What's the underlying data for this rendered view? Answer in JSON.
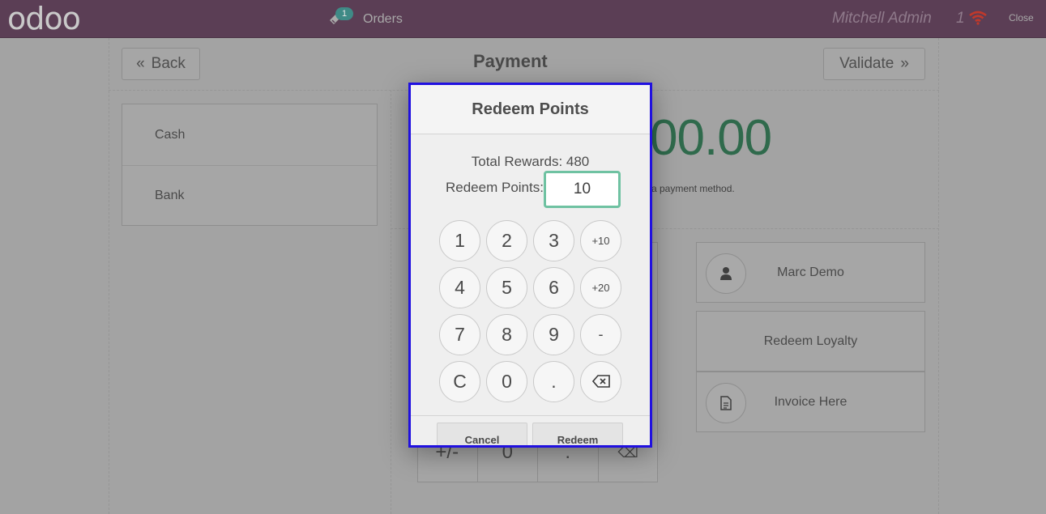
{
  "topbar": {
    "logo": "odoo",
    "orders_label": "Orders",
    "orders_count": "1",
    "user": "Mitchell Admin",
    "pending": "1",
    "close_label": "Close"
  },
  "payment": {
    "back_label": "Back",
    "title": "Payment",
    "validate_label": "Validate",
    "methods": [
      "Cash",
      "Bank"
    ],
    "amount_partial": "00.00",
    "hint_partial": "a payment method.",
    "numpad_bottom": [
      "+/-",
      "0",
      ".",
      "⌫"
    ],
    "actions": {
      "customer": "Marc Demo",
      "loyalty": "Redeem Loyalty",
      "invoice": "Invoice Here"
    }
  },
  "modal": {
    "title": "Redeem Points",
    "total_rewards": "Total Rewards: 480",
    "redeem_label": "Redeem Points:",
    "redeem_value": "10",
    "keys": [
      "1",
      "2",
      "3",
      "+10",
      "4",
      "5",
      "6",
      "+20",
      "7",
      "8",
      "9",
      "-",
      "C",
      "0",
      ".",
      "backspace"
    ],
    "cancel_label": "Cancel",
    "redeem_button_label": "Redeem"
  },
  "icons": {
    "orders": "ticket-icon",
    "connection": "wifi-icon",
    "back": "double-chevron-left-icon",
    "validate": "double-chevron-right-icon",
    "customer": "user-icon",
    "invoice": "document-icon",
    "backspace": "backspace-icon"
  },
  "colors": {
    "topbar": "#5b3e55",
    "accent_green": "#2f6a4c",
    "input_focus": "#6fc2a2",
    "modal_highlight": "#2010e0",
    "wifi": "#c0392b"
  }
}
